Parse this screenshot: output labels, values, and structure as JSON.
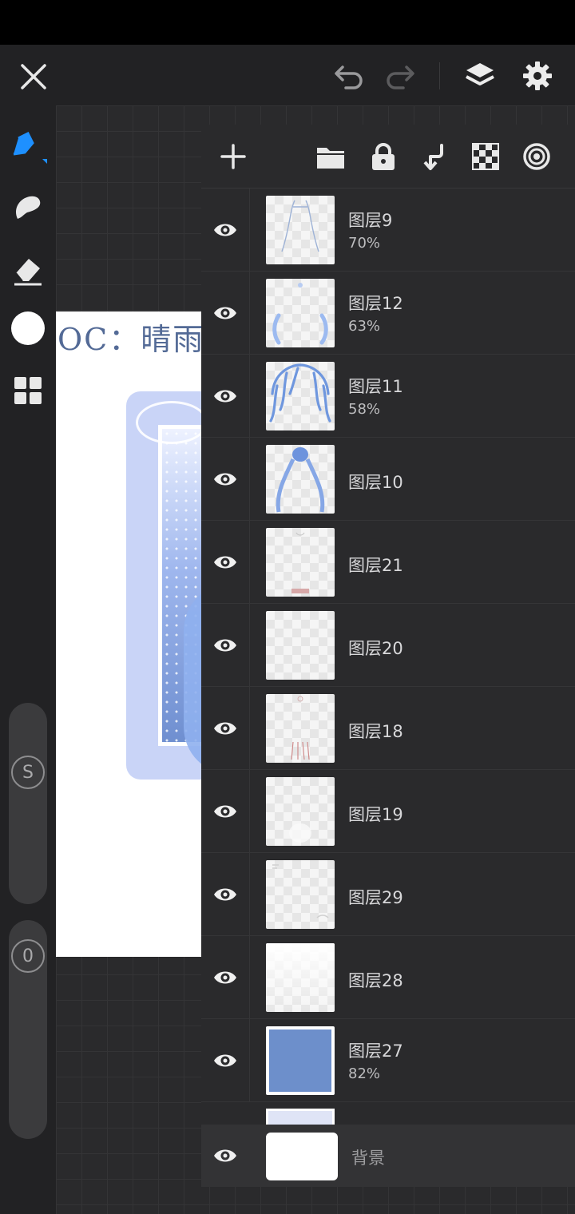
{
  "canvas": {
    "title_text": "OC：晴雨"
  },
  "layers": [
    {
      "name": "图层9",
      "opacity": "70%",
      "thumb": "lineart"
    },
    {
      "name": "图层12",
      "opacity": "63%",
      "thumb": "hair-sides"
    },
    {
      "name": "图层11",
      "opacity": "58%",
      "thumb": "hair-front"
    },
    {
      "name": "图层10",
      "opacity": "",
      "thumb": "hair-long"
    },
    {
      "name": "图层21",
      "opacity": "",
      "thumb": "sketch-red"
    },
    {
      "name": "图层20",
      "opacity": "",
      "thumb": "empty"
    },
    {
      "name": "图层18",
      "opacity": "",
      "thumb": "sketch-red-legs"
    },
    {
      "name": "图层19",
      "opacity": "",
      "thumb": "faint"
    },
    {
      "name": "图层29",
      "opacity": "",
      "thumb": "faint-corners"
    },
    {
      "name": "图层28",
      "opacity": "",
      "thumb": "white-fade"
    },
    {
      "name": "图层27",
      "opacity": "82%",
      "thumb": "blue-fill"
    }
  ],
  "background_layer": {
    "name": "背景"
  },
  "sliders": {
    "size_label": "S",
    "opacity_label": "0"
  },
  "colors": {
    "accent": "#1e90ff",
    "panel_bg": "#2a2a2c",
    "canvas_bg": "#2a2a2c",
    "current_color": "#ffffff",
    "title_text": "#536a96",
    "art_blue": "#6d8fcb"
  },
  "icons": {
    "top_left": "close-icon",
    "undo": "undo-icon",
    "redo": "redo-icon",
    "layers": "layers-icon",
    "settings": "gear-icon",
    "tools": [
      "brush-icon",
      "smudge-icon",
      "eraser-icon",
      "color-swatch",
      "grid-menu-icon"
    ],
    "layer_toolbar": [
      "add-layer-icon",
      "folder-icon",
      "lock-icon",
      "merge-down-icon",
      "transparency-icon",
      "blend-icon"
    ],
    "row": "eye-icon"
  }
}
